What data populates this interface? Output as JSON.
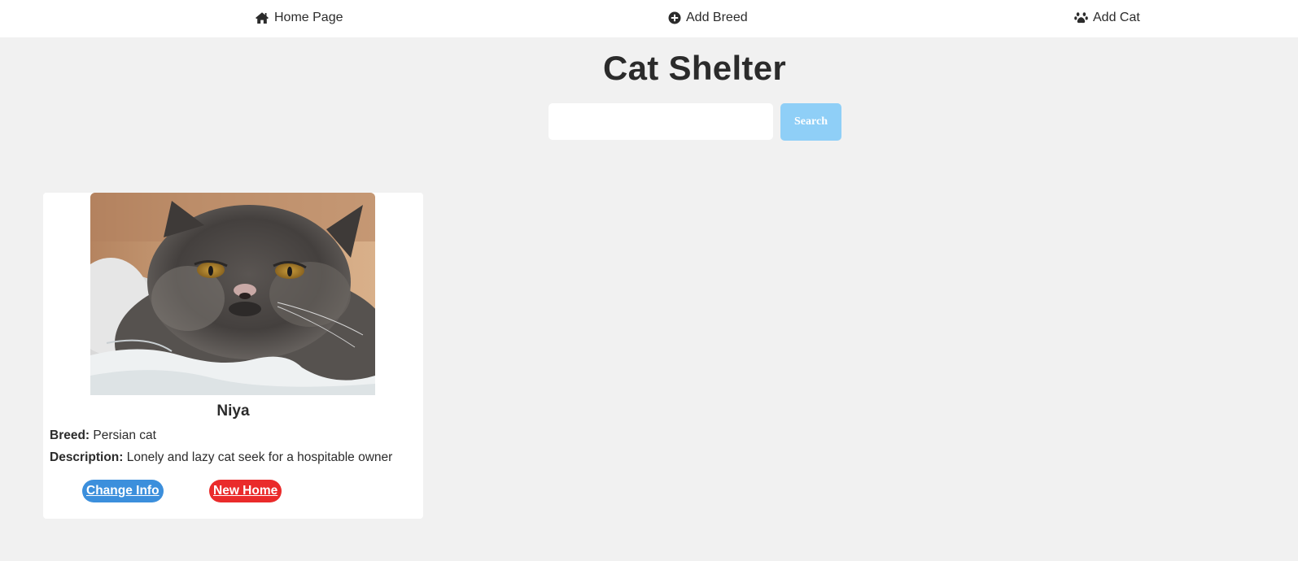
{
  "nav": {
    "items": [
      {
        "label": "Home Page",
        "icon": "home-icon"
      },
      {
        "label": "Add Breed",
        "icon": "plus-circle-icon"
      },
      {
        "label": "Add Cat",
        "icon": "paw-icon"
      }
    ]
  },
  "page": {
    "title": "Cat Shelter"
  },
  "search": {
    "value": "",
    "placeholder": "",
    "button_label": "Search",
    "button_color": "#8fcff7"
  },
  "cats": [
    {
      "name": "Niya",
      "breed_label": "Breed:",
      "breed": "Persian cat",
      "description_label": "Description:",
      "description": "Lonely and lazy cat seek for a hospitable owner",
      "actions": {
        "change_label": "Change Info",
        "new_home_label": "New Home"
      }
    }
  ],
  "colors": {
    "background": "#f1f1f1",
    "change_button": "#3c8fdc",
    "new_home_button": "#ea2b2b",
    "text": "#2b2b2b"
  }
}
